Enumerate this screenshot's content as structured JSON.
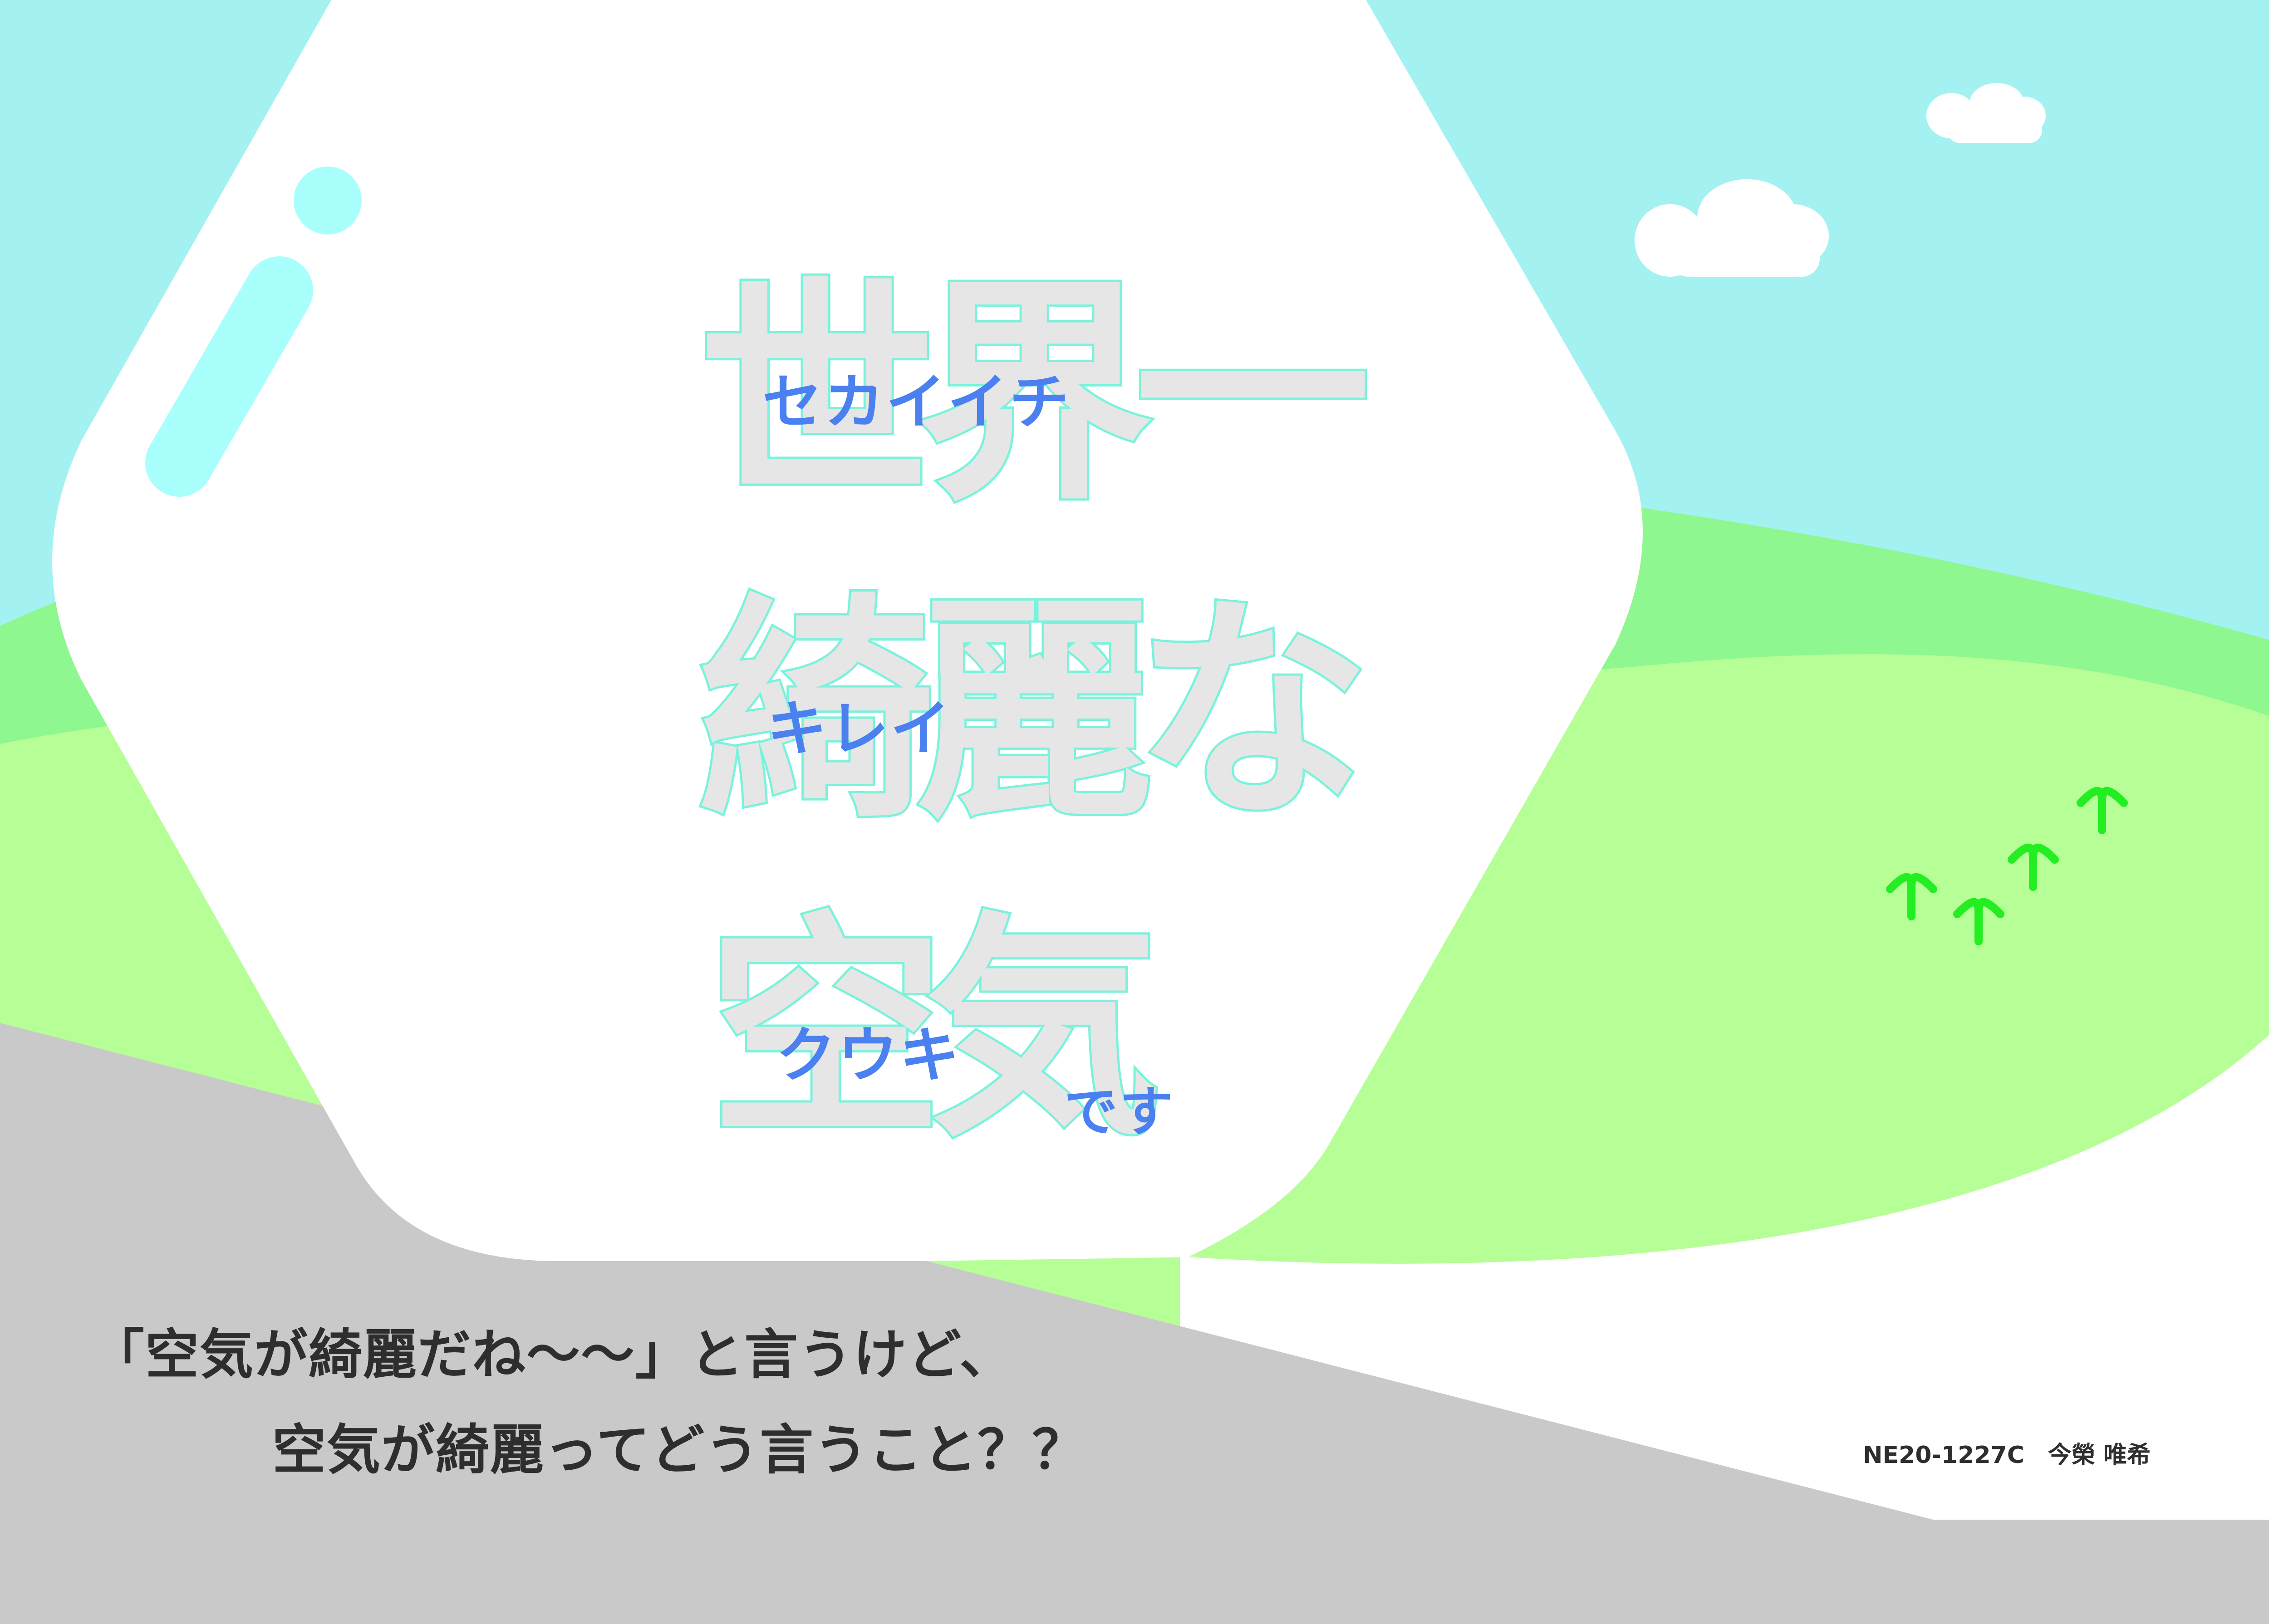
{
  "colors": {
    "sky": "#a4f1f1",
    "hill_back": "#8ef78f",
    "hill_front": "#b6fe96",
    "ground_gray": "#c9c9c9",
    "bubble": "#ffffff",
    "accent_cyan": "#a8fffb",
    "cloud": "#ffffff",
    "sprout": "#22ee22",
    "title_fill": "#e6e6e6",
    "title_outline": "#7af2dc",
    "ruby_blue": "#4a80f0",
    "body_text": "#2e2e2e"
  },
  "title": {
    "line1": {
      "kanji": "世界一",
      "reading": "セカイイチ"
    },
    "line2": {
      "kanji": "綺麗な",
      "reading": "キレイ"
    },
    "line3": {
      "kanji": "空気",
      "reading": "クウキ",
      "suffix": "です"
    }
  },
  "body": {
    "line1": "「空気が綺麗だね～～」と言うけど、",
    "line2": "空気が綺麗ってどう言うこと？？"
  },
  "credit": "NE20-1227C　今榮 唯希",
  "icons": [
    "cloud-icon",
    "cloud-icon",
    "sprout-icon",
    "sprout-icon",
    "sprout-icon",
    "sprout-icon",
    "exclamation-mark-icon"
  ]
}
